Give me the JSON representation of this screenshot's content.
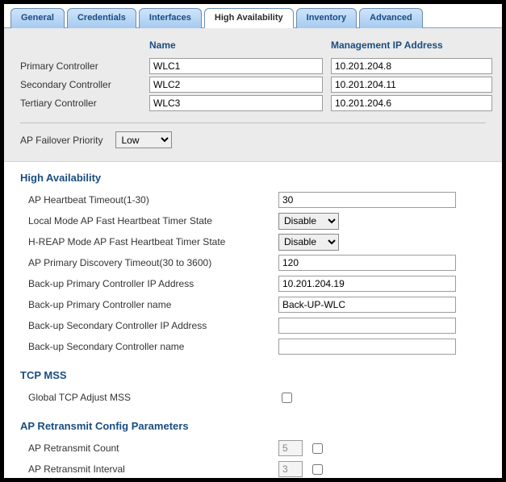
{
  "tabs": {
    "general": "General",
    "credentials": "Credentials",
    "interfaces": "Interfaces",
    "high_availability": "High Availability",
    "inventory": "Inventory",
    "advanced": "Advanced"
  },
  "controllers": {
    "header_name": "Name",
    "header_mgmt_ip": "Management IP Address",
    "primary_label": "Primary Controller",
    "secondary_label": "Secondary Controller",
    "tertiary_label": "Tertiary Controller",
    "primary_name": "WLC1",
    "secondary_name": "WLC2",
    "tertiary_name": "WLC3",
    "primary_ip": "10.201.204.8",
    "secondary_ip": "10.201.204.11",
    "tertiary_ip": "10.201.204.6"
  },
  "failover": {
    "label": "AP Failover Priority",
    "selected": "Low",
    "options": [
      "Low"
    ]
  },
  "ha_section": {
    "title": "High Availability",
    "heartbeat_label": "AP Heartbeat Timeout(1-30)",
    "heartbeat_value": "30",
    "local_fast_label": "Local Mode AP Fast Heartbeat Timer State",
    "local_fast_value": "Disable",
    "hreap_fast_label": "H-REAP Mode AP Fast Heartbeat Timer State",
    "hreap_fast_value": "Disable",
    "discovery_label": "AP Primary Discovery Timeout(30 to 3600)",
    "discovery_value": "120",
    "bkp_pri_ip_label": "Back-up Primary Controller IP Address",
    "bkp_pri_ip_value": "10.201.204.19",
    "bkp_pri_name_label": "Back-up Primary Controller name",
    "bkp_pri_name_value": "Back-UP-WLC",
    "bkp_sec_ip_label": "Back-up Secondary Controller IP Address",
    "bkp_sec_ip_value": "",
    "bkp_sec_name_label": "Back-up Secondary Controller name",
    "bkp_sec_name_value": ""
  },
  "tcp_section": {
    "title": "TCP MSS",
    "global_label": "Global TCP Adjust MSS"
  },
  "retransmit_section": {
    "title": "AP Retransmit Config Parameters",
    "count_label": "AP Retransmit Count",
    "count_value": "5",
    "interval_label": "AP Retransmit Interval",
    "interval_value": "3"
  }
}
